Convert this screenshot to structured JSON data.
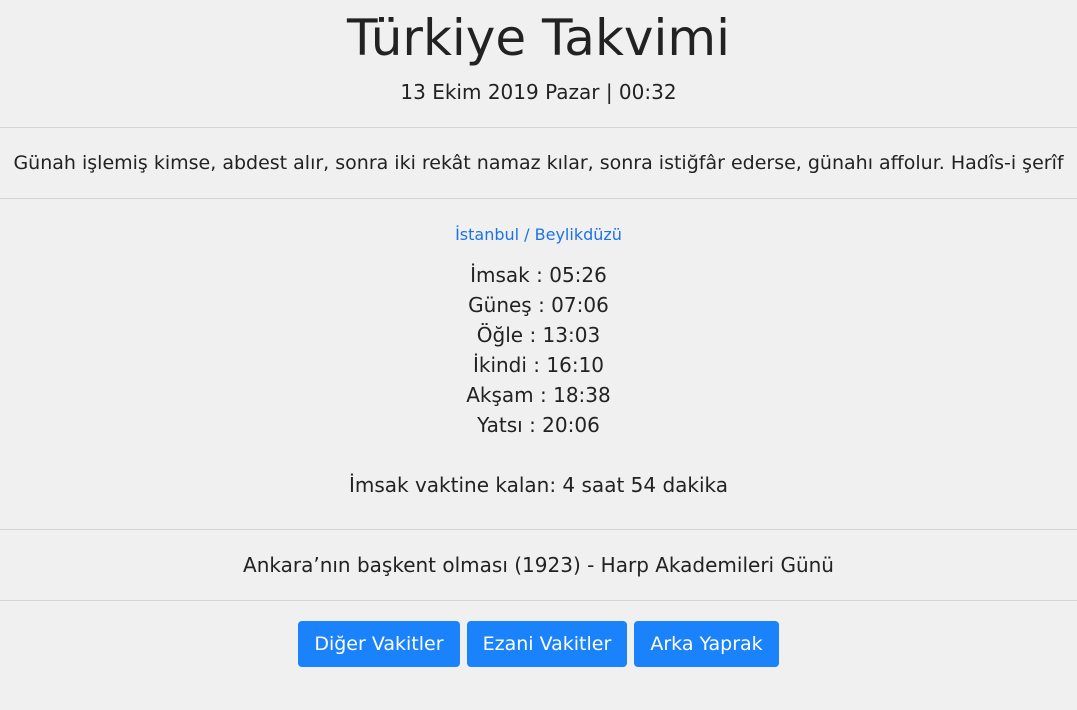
{
  "header": {
    "title": "Türkiye Takvimi",
    "datetime": "13 Ekim 2019 Pazar | 00:32"
  },
  "quote": {
    "text": "Günah işlemiş kimse, abdest alır, sonra iki rekât namaz kılar, sonra istiğfâr ederse, günahı affolur. Hadîs-i şerîf"
  },
  "location": {
    "label": "İstanbul / Beylikdüzü"
  },
  "prayer_times": [
    {
      "text": "İmsak : 05:26"
    },
    {
      "text": "Güneş : 07:06"
    },
    {
      "text": "Öğle : 13:03"
    },
    {
      "text": "İkindi : 16:10"
    },
    {
      "text": "Akşam : 18:38"
    },
    {
      "text": "Yatsı : 20:06"
    }
  ],
  "remaining": {
    "text": "İmsak vaktine kalan: 4 saat 54 dakika"
  },
  "event": {
    "text": "Ankara’nın başkent olması (1923) - Harp Akademileri Günü"
  },
  "buttons": {
    "other_times": "Diğer Vakitler",
    "ezani_times": "Ezani Vakitler",
    "back_page": "Arka Yaprak"
  },
  "colors": {
    "background": "#f0f0f0",
    "accent": "#1a82fb",
    "link": "#1a73e8",
    "divider": "#d6d6d6"
  }
}
